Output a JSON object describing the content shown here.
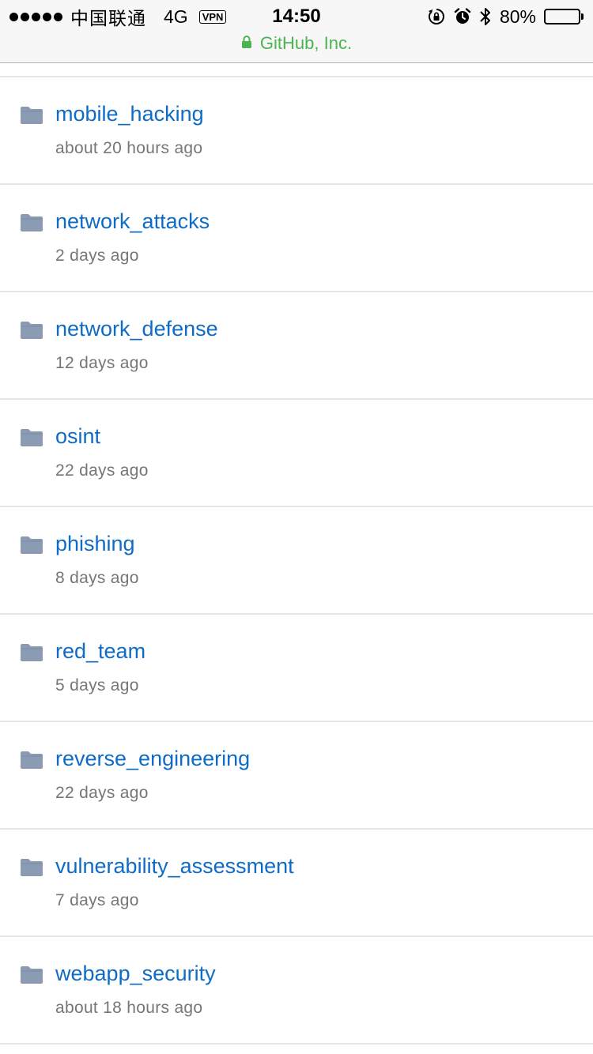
{
  "status_bar": {
    "carrier": "中国联通",
    "network": "4G",
    "vpn": "VPN",
    "time": "14:50",
    "battery_percent": "80%",
    "battery_level": 0.8,
    "icons": [
      "signal-icon",
      "orientation-lock-icon",
      "alarm-icon",
      "bluetooth-icon",
      "battery-icon"
    ]
  },
  "url_bar": {
    "site": "GitHub, Inc.",
    "icon": "lock-icon",
    "color": "#4cb351"
  },
  "colors": {
    "link": "#0f6cc6",
    "meta": "#767676",
    "folder": "#8a9bb3",
    "divider": "#e5e5e5"
  },
  "files": [
    {
      "name": "mobile_hacking",
      "age": "about 20 hours ago",
      "icon": "folder-icon"
    },
    {
      "name": "network_attacks",
      "age": "2 days ago",
      "icon": "folder-icon"
    },
    {
      "name": "network_defense",
      "age": "12 days ago",
      "icon": "folder-icon"
    },
    {
      "name": "osint",
      "age": "22 days ago",
      "icon": "folder-icon"
    },
    {
      "name": "phishing",
      "age": "8 days ago",
      "icon": "folder-icon"
    },
    {
      "name": "red_team",
      "age": "5 days ago",
      "icon": "folder-icon"
    },
    {
      "name": "reverse_engineering",
      "age": "22 days ago",
      "icon": "folder-icon"
    },
    {
      "name": "vulnerability_assessment",
      "age": "7 days ago",
      "icon": "folder-icon"
    },
    {
      "name": "webapp_security",
      "age": "about 18 hours ago",
      "icon": "folder-icon"
    }
  ]
}
